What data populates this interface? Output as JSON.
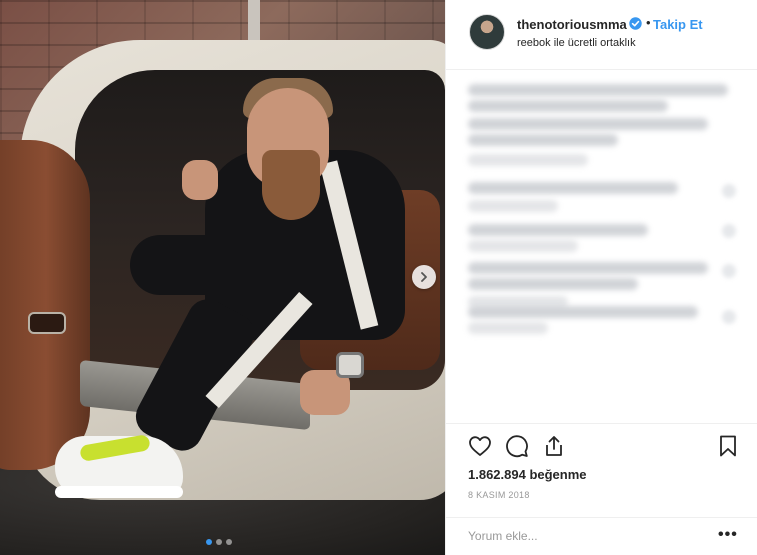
{
  "header": {
    "username": "thenotoriousmma",
    "separator": "•",
    "follow_label": "Takip Et",
    "partnership_text": "reebok ile ücretli ortaklık"
  },
  "media": {
    "carousel_active_index": 0,
    "carousel_count": 3,
    "next_icon": "chevron-right-icon"
  },
  "actions": {
    "icons": [
      "heart-icon",
      "comment-icon",
      "share-icon",
      "bookmark-icon"
    ],
    "likes_text": "1.862.894 beğenme",
    "date_text": "8 KASIM 2018",
    "more_label": "•••"
  },
  "comment_box": {
    "placeholder": "Yorum ekle..."
  },
  "colors": {
    "accent": "#3897f0",
    "text": "#262626",
    "muted": "#999999",
    "border": "#efefef"
  }
}
